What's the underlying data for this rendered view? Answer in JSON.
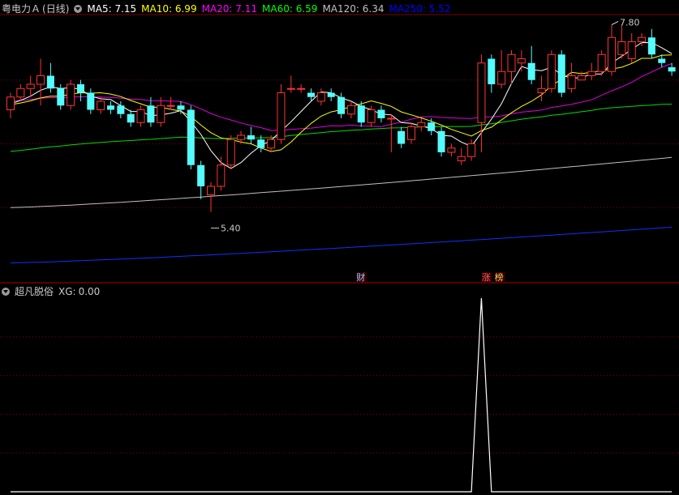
{
  "main_panel": {
    "title": "粤电力Ａ",
    "period": "(日线)",
    "ma": [
      {
        "label": "MA5:",
        "value": "7.15",
        "color": "#ffffff"
      },
      {
        "label": "MA10:",
        "value": "6.99",
        "color": "#ffff00"
      },
      {
        "label": "MA20:",
        "value": "7.11",
        "color": "#ff00ff"
      },
      {
        "label": "MA60:",
        "value": "6.59",
        "color": "#00ff00"
      },
      {
        "label": "MA120:",
        "value": "6.34",
        "color": "#c0c0c0"
      },
      {
        "label": "MA250:",
        "value": "5.52",
        "color": "#0000ff"
      }
    ],
    "high_marker": "7.80",
    "low_marker": "5.40",
    "event_markers": [
      {
        "text": "财",
        "color": "#9fc7ff"
      },
      {
        "text": "涨",
        "color": "#ff6060"
      },
      {
        "text": "榜",
        "color": "#ffd060"
      }
    ]
  },
  "sub_panel": {
    "title": "超凡脱俗",
    "label": "XG:",
    "value": "0.00"
  },
  "colors": {
    "up": "#ff3232",
    "down": "#54fcfc",
    "grid": "#7a0000",
    "bg": "#000000",
    "xg_line": "#ffffff"
  },
  "chart_data": [
    {
      "type": "candlestick",
      "ylim": [
        5.0,
        8.0
      ],
      "candles": [
        [
          6.9,
          7.05,
          6.8,
          7.1
        ],
        [
          7.05,
          7.15,
          7.0,
          7.2
        ],
        [
          7.15,
          7.2,
          7.05,
          7.3
        ],
        [
          7.2,
          7.3,
          6.95,
          7.5
        ],
        [
          7.3,
          7.15,
          7.1,
          7.45
        ],
        [
          7.15,
          6.95,
          6.9,
          7.2
        ],
        [
          6.95,
          7.2,
          6.9,
          7.25
        ],
        [
          7.2,
          7.1,
          7.0,
          7.25
        ],
        [
          7.1,
          6.9,
          6.85,
          7.15
        ],
        [
          6.9,
          7.0,
          6.85,
          7.05
        ],
        [
          6.95,
          6.9,
          6.85,
          7.0
        ],
        [
          6.95,
          6.85,
          6.8,
          7.0
        ],
        [
          6.85,
          6.75,
          6.7,
          6.9
        ],
        [
          6.75,
          6.9,
          6.7,
          6.95
        ],
        [
          6.95,
          6.75,
          6.7,
          7.05
        ],
        [
          6.75,
          6.95,
          6.7,
          7.05
        ],
        [
          6.95,
          6.95,
          6.9,
          7.05
        ],
        [
          6.95,
          6.9,
          6.85,
          7.0
        ],
        [
          6.9,
          6.25,
          6.2,
          6.95
        ],
        [
          6.25,
          6.0,
          5.85,
          6.3
        ],
        [
          5.9,
          6.0,
          5.7,
          6.05
        ],
        [
          6.0,
          6.25,
          5.95,
          6.35
        ],
        [
          6.25,
          6.55,
          6.2,
          6.6
        ],
        [
          6.55,
          6.6,
          6.5,
          6.65
        ],
        [
          6.6,
          6.55,
          6.5,
          6.7
        ],
        [
          6.55,
          6.45,
          6.4,
          6.6
        ],
        [
          6.45,
          6.55,
          6.4,
          6.6
        ],
        [
          6.55,
          7.1,
          6.5,
          7.2
        ],
        [
          7.15,
          7.15,
          7.1,
          7.3
        ],
        [
          7.15,
          7.15,
          7.1,
          7.2
        ],
        [
          7.1,
          7.05,
          7.0,
          7.15
        ],
        [
          7.0,
          7.1,
          6.95,
          7.15
        ],
        [
          7.1,
          7.05,
          7.0,
          7.15
        ],
        [
          7.05,
          6.85,
          6.8,
          7.1
        ],
        [
          6.85,
          6.95,
          6.8,
          7.0
        ],
        [
          6.95,
          6.75,
          6.7,
          7.0
        ],
        [
          6.75,
          6.9,
          6.7,
          6.95
        ],
        [
          6.9,
          6.8,
          6.75,
          6.95
        ],
        [
          6.8,
          6.8,
          6.4,
          6.85
        ],
        [
          6.65,
          6.5,
          6.45,
          6.7
        ],
        [
          6.55,
          6.7,
          6.5,
          6.75
        ],
        [
          6.7,
          6.75,
          6.65,
          6.8
        ],
        [
          6.75,
          6.65,
          6.6,
          6.8
        ],
        [
          6.65,
          6.4,
          6.35,
          6.7
        ],
        [
          6.4,
          6.45,
          6.35,
          6.5
        ],
        [
          6.3,
          6.35,
          6.25,
          6.45
        ],
        [
          6.35,
          6.5,
          6.3,
          6.55
        ],
        [
          6.75,
          7.45,
          6.4,
          7.55
        ],
        [
          7.5,
          7.2,
          7.1,
          7.55
        ],
        [
          7.2,
          7.35,
          7.15,
          7.6
        ],
        [
          7.35,
          7.55,
          7.2,
          7.6
        ],
        [
          7.45,
          7.5,
          7.35,
          7.6
        ],
        [
          7.45,
          7.25,
          7.2,
          7.65
        ],
        [
          7.1,
          7.15,
          7.0,
          7.3
        ],
        [
          7.15,
          7.55,
          7.1,
          7.6
        ],
        [
          7.55,
          7.1,
          7.05,
          7.6
        ],
        [
          7.15,
          7.3,
          7.1,
          7.45
        ],
        [
          7.25,
          7.3,
          7.25,
          7.35
        ],
        [
          7.3,
          7.35,
          7.25,
          7.45
        ],
        [
          7.35,
          7.55,
          7.3,
          7.6
        ],
        [
          7.35,
          7.75,
          7.3,
          7.9
        ],
        [
          7.55,
          7.7,
          7.5,
          7.9
        ],
        [
          7.5,
          7.7,
          7.45,
          7.8
        ],
        [
          7.7,
          7.75,
          7.65,
          7.8
        ],
        [
          7.75,
          7.55,
          7.5,
          7.85
        ],
        [
          7.5,
          7.45,
          7.4,
          7.55
        ],
        [
          7.4,
          7.35,
          7.3,
          7.45
        ]
      ],
      "xg": [
        0,
        0,
        0,
        0,
        0,
        0,
        0,
        0,
        0,
        0,
        0,
        0,
        0,
        0,
        0,
        0,
        0,
        0,
        0,
        0,
        0,
        0,
        0,
        0,
        0,
        0,
        0,
        0,
        0,
        0,
        0,
        0,
        0,
        0,
        0,
        0,
        0,
        0,
        0,
        0,
        0,
        0,
        0,
        0,
        0,
        0,
        0,
        1,
        0,
        0,
        0,
        0,
        0,
        0,
        0,
        0,
        0,
        0,
        0,
        0,
        0,
        0,
        0,
        0,
        0,
        0,
        0
      ],
      "ma250_start": 5.1,
      "ma250_end": 5.52,
      "ma120_start": 5.75,
      "ma120_end": 6.34,
      "ma60_start": 6.4,
      "ma60_end": 6.59
    }
  ]
}
